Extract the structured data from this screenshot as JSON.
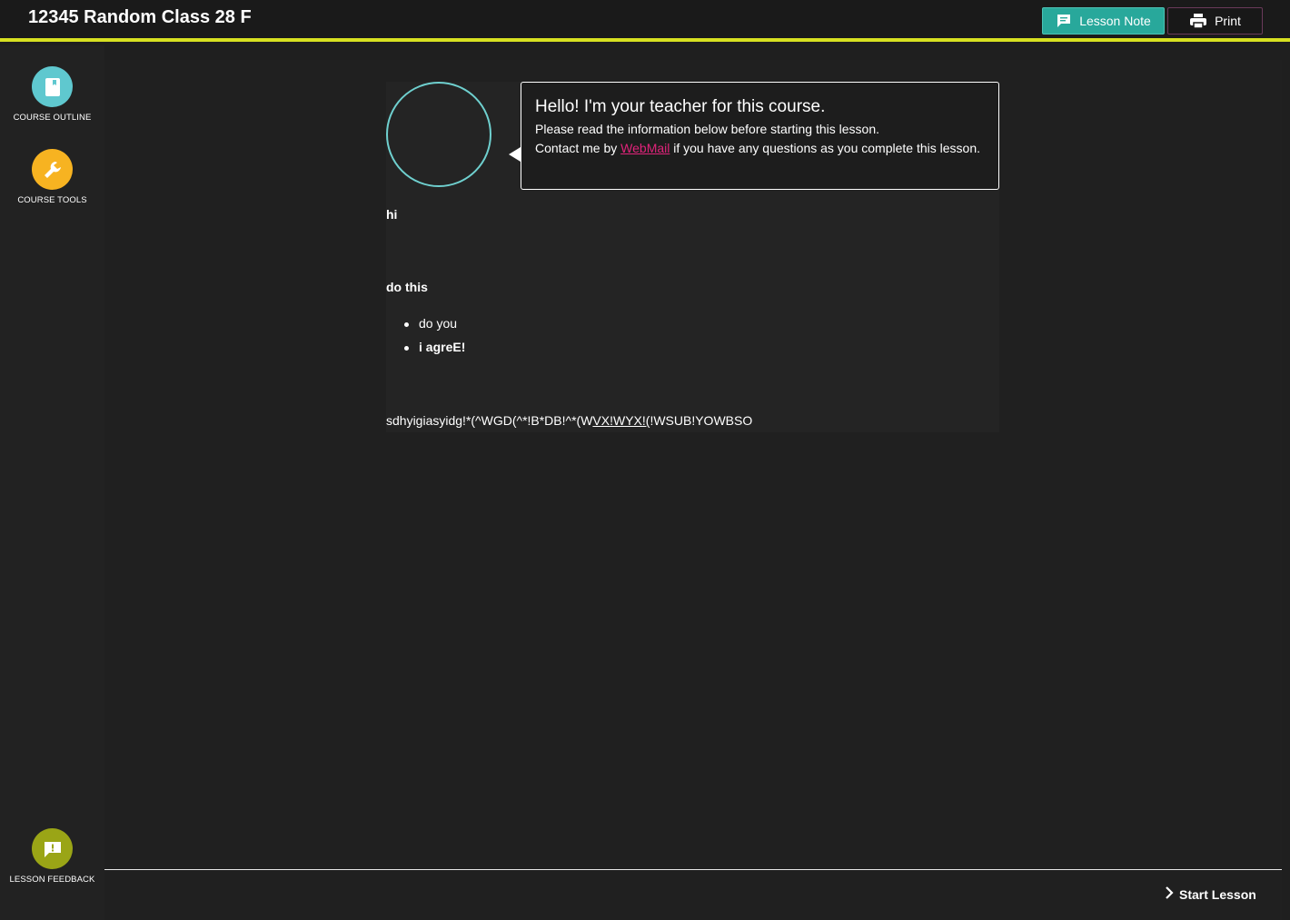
{
  "header": {
    "title": "12345 Random Class 28 F",
    "lesson_note_label": "Lesson Note",
    "print_label": "Print"
  },
  "sidebar": {
    "items": [
      {
        "label": "COURSE OUTLINE",
        "icon": "book-icon",
        "color": "#5fc8cf"
      },
      {
        "label": "COURSE TOOLS",
        "icon": "wrench-icon",
        "color": "#f7b321"
      }
    ],
    "feedback": {
      "label": "LESSON FEEDBACK",
      "icon": "feedback-icon",
      "color": "#9aa516"
    }
  },
  "teacher": {
    "greeting": "Hello! I'm your teacher for this course.",
    "instruction": "Please read the information below before starting this lesson.",
    "contact_prefix": "Contact me by ",
    "contact_link": "WebMail",
    "contact_suffix": " if you have any questions as you complete this lesson."
  },
  "lesson": {
    "line1": "hi",
    "heading": "do this",
    "bullets": [
      "do you",
      "i agreE!"
    ],
    "long_text_a": "sdhyigiasyidg!*(^WGD(^*!B*DB!^*(W",
    "long_text_b": "VX!WYX!(",
    "long_text_c": "!WSUB!YOWBSO"
  },
  "footer": {
    "start_label": "Start Lesson"
  },
  "colors": {
    "accent_bar": "#d7e021",
    "lesson_note_bg": "#28a89b",
    "link": "#e0237a",
    "avatar_ring": "#6fd0cf"
  }
}
